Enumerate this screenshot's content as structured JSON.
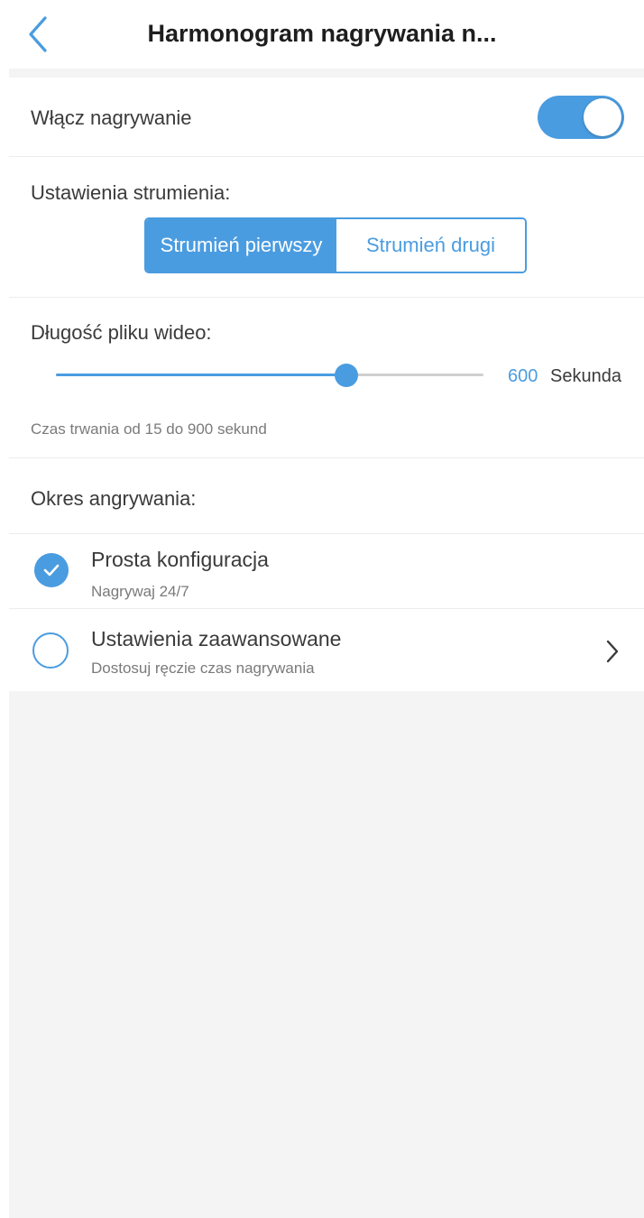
{
  "header": {
    "title": "Harmonogram nagrywania n...",
    "back_icon": "chevron-left-icon"
  },
  "recording": {
    "label": "Włącz nagrywanie",
    "enabled": true
  },
  "stream": {
    "label": "Ustawienia strumienia:",
    "options": [
      "Strumień pierwszy",
      "Strumień drugi"
    ],
    "selected": "Strumień pierwszy"
  },
  "file_length": {
    "label": "Długość pliku wideo:",
    "value": "600",
    "unit": "Sekunda",
    "min": 15,
    "max": 900,
    "fraction": 0.68,
    "hint": "Czas trwania od 15 do 900 sekund"
  },
  "period": {
    "label": "Okres angrywania:",
    "options": [
      {
        "title": "Prosta konfiguracja",
        "subtitle": "Nagrywaj 24/7",
        "selected": true,
        "icon": "check-circle-icon"
      },
      {
        "title": "Ustawienia zaawansowane",
        "subtitle": "Dostosuj ręczie czas nagrywania",
        "selected": false,
        "icon": "radio-empty-icon",
        "trailing_icon": "chevron-right-icon"
      }
    ]
  },
  "colors": {
    "accent": "#4a9ce0",
    "background_gray": "#f4f4f4",
    "text": "#3a3a3a",
    "subtext": "#7a7a7a"
  }
}
